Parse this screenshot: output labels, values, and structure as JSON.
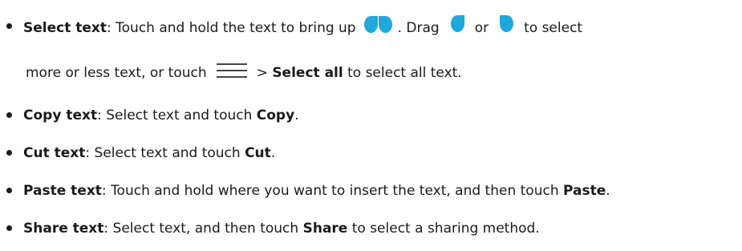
{
  "items": [
    {
      "term": "Select text",
      "sep": ": ",
      "text1": "Touch and hold the text to bring up",
      "icon1": "selection-handles-icon",
      "text2": ". Drag",
      "icon2": "left-handle-icon",
      "text3": "or",
      "icon3": "right-handle-icon",
      "text4": "to select",
      "cont1": "more or less text, or touch",
      "icon4": "menu-icon",
      "cont2": "> ",
      "cont_bold": "Select all",
      "cont3": " to select all text."
    },
    {
      "term": "Copy text",
      "sep": ": ",
      "text1": "Select text and touch ",
      "bold": "Copy",
      "text2": "."
    },
    {
      "term": "Cut text",
      "sep": ": ",
      "text1": "Select text and touch ",
      "bold": "Cut",
      "text2": "."
    },
    {
      "term": "Paste text",
      "sep": ": ",
      "text1": "Touch and hold where you want to insert the text, and then touch ",
      "bold": "Paste",
      "text2": "."
    },
    {
      "term": "Share text",
      "sep": ": ",
      "text1": "Select text, and then touch ",
      "bold": "Share",
      "text2": " to select a sharing method."
    }
  ],
  "colors": {
    "text": "#1a1a1a",
    "handle": "#1ea8dc"
  }
}
